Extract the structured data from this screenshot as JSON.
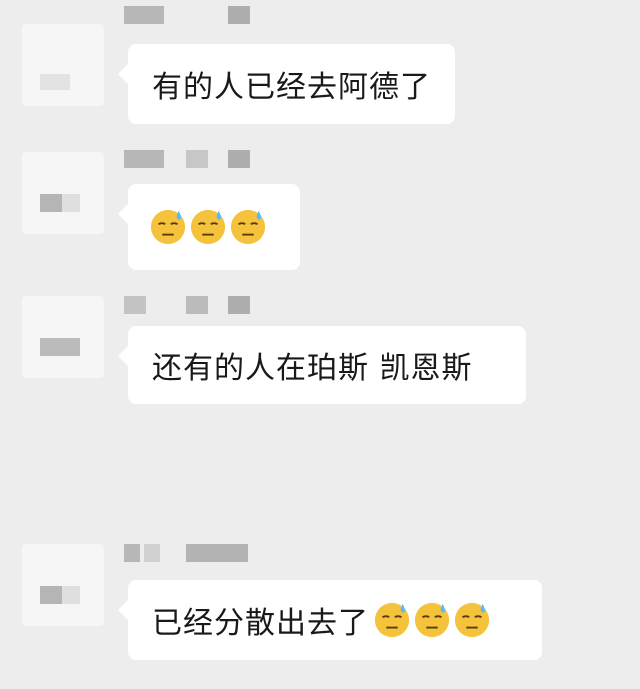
{
  "chat": {
    "messages": [
      {
        "text": "有的人已经去阿德了",
        "emoji_count": 0
      },
      {
        "text": "",
        "emoji_count": 3
      },
      {
        "text": "还有的人在珀斯 凯恩斯",
        "emoji_count": 0
      },
      {
        "text": "已经分散出去了",
        "emoji_count": 3
      }
    ]
  },
  "emoji": {
    "name": "sweat-smile-icon",
    "face_color": "#f5c33b",
    "drop_color": "#5bb8f2"
  },
  "colors": {
    "background": "#ededed",
    "bubble": "#ffffff",
    "text": "#191919"
  }
}
